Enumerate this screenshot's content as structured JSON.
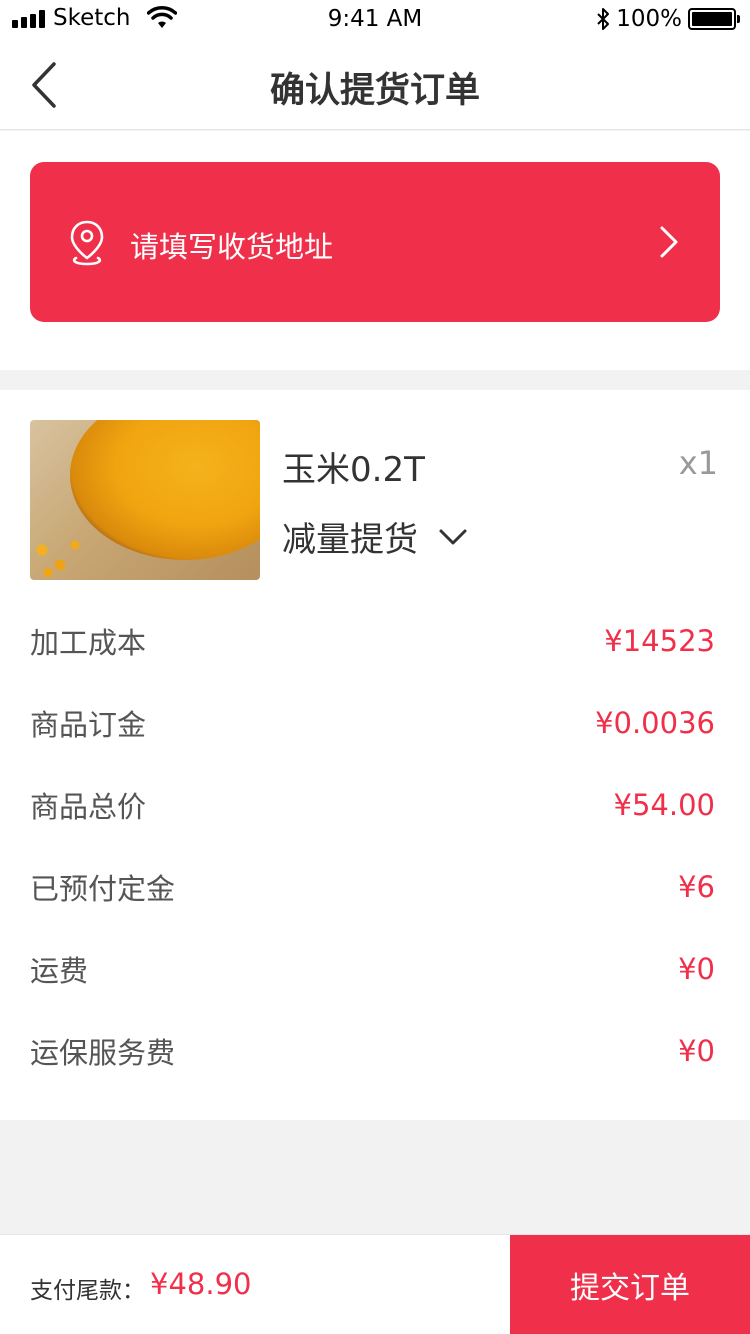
{
  "status_bar": {
    "carrier": "Sketch",
    "time": "9:41 AM",
    "battery": "100%"
  },
  "nav": {
    "title": "确认提货订单"
  },
  "address": {
    "placeholder": "请填写收货地址"
  },
  "product": {
    "name": "玉米0.2T",
    "quantity": "x1",
    "reduce_label": "减量提货"
  },
  "costs": [
    {
      "label": "加工成本",
      "value": "¥14523"
    },
    {
      "label": "商品订金",
      "value": "¥0.0036"
    },
    {
      "label": "商品总价",
      "value": "¥54.00"
    },
    {
      "label": "已预付定金",
      "value": "¥6"
    },
    {
      "label": "运费",
      "value": "¥0"
    },
    {
      "label": "运保服务费",
      "value": "¥0"
    }
  ],
  "footer": {
    "pay_label": "支付尾款：",
    "pay_amount": "¥48.90",
    "submit_label": "提交订单"
  },
  "colors": {
    "accent": "#f0304a",
    "background": "#f2f2f2"
  }
}
